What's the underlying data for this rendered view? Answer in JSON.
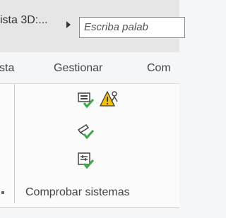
{
  "titlebar": {
    "view_title": "ista 3D:...",
    "search_placeholder": "Escriba palab"
  },
  "ribbon": {
    "tabs": [
      {
        "label": "sta"
      },
      {
        "label": "Gestionar"
      },
      {
        "label": "Com"
      }
    ]
  },
  "panel": {
    "label": "Comprobar sistemas",
    "tools": [
      {
        "icon": "check-system-icon"
      },
      {
        "icon": "warning-person-icon"
      },
      {
        "icon": "check-connection-icon"
      },
      {
        "icon": "check-circuit-icon"
      }
    ]
  },
  "colors": {
    "check_green": "#39a845",
    "warning_yellow": "#f4c000",
    "icon_outline": "#444444"
  }
}
